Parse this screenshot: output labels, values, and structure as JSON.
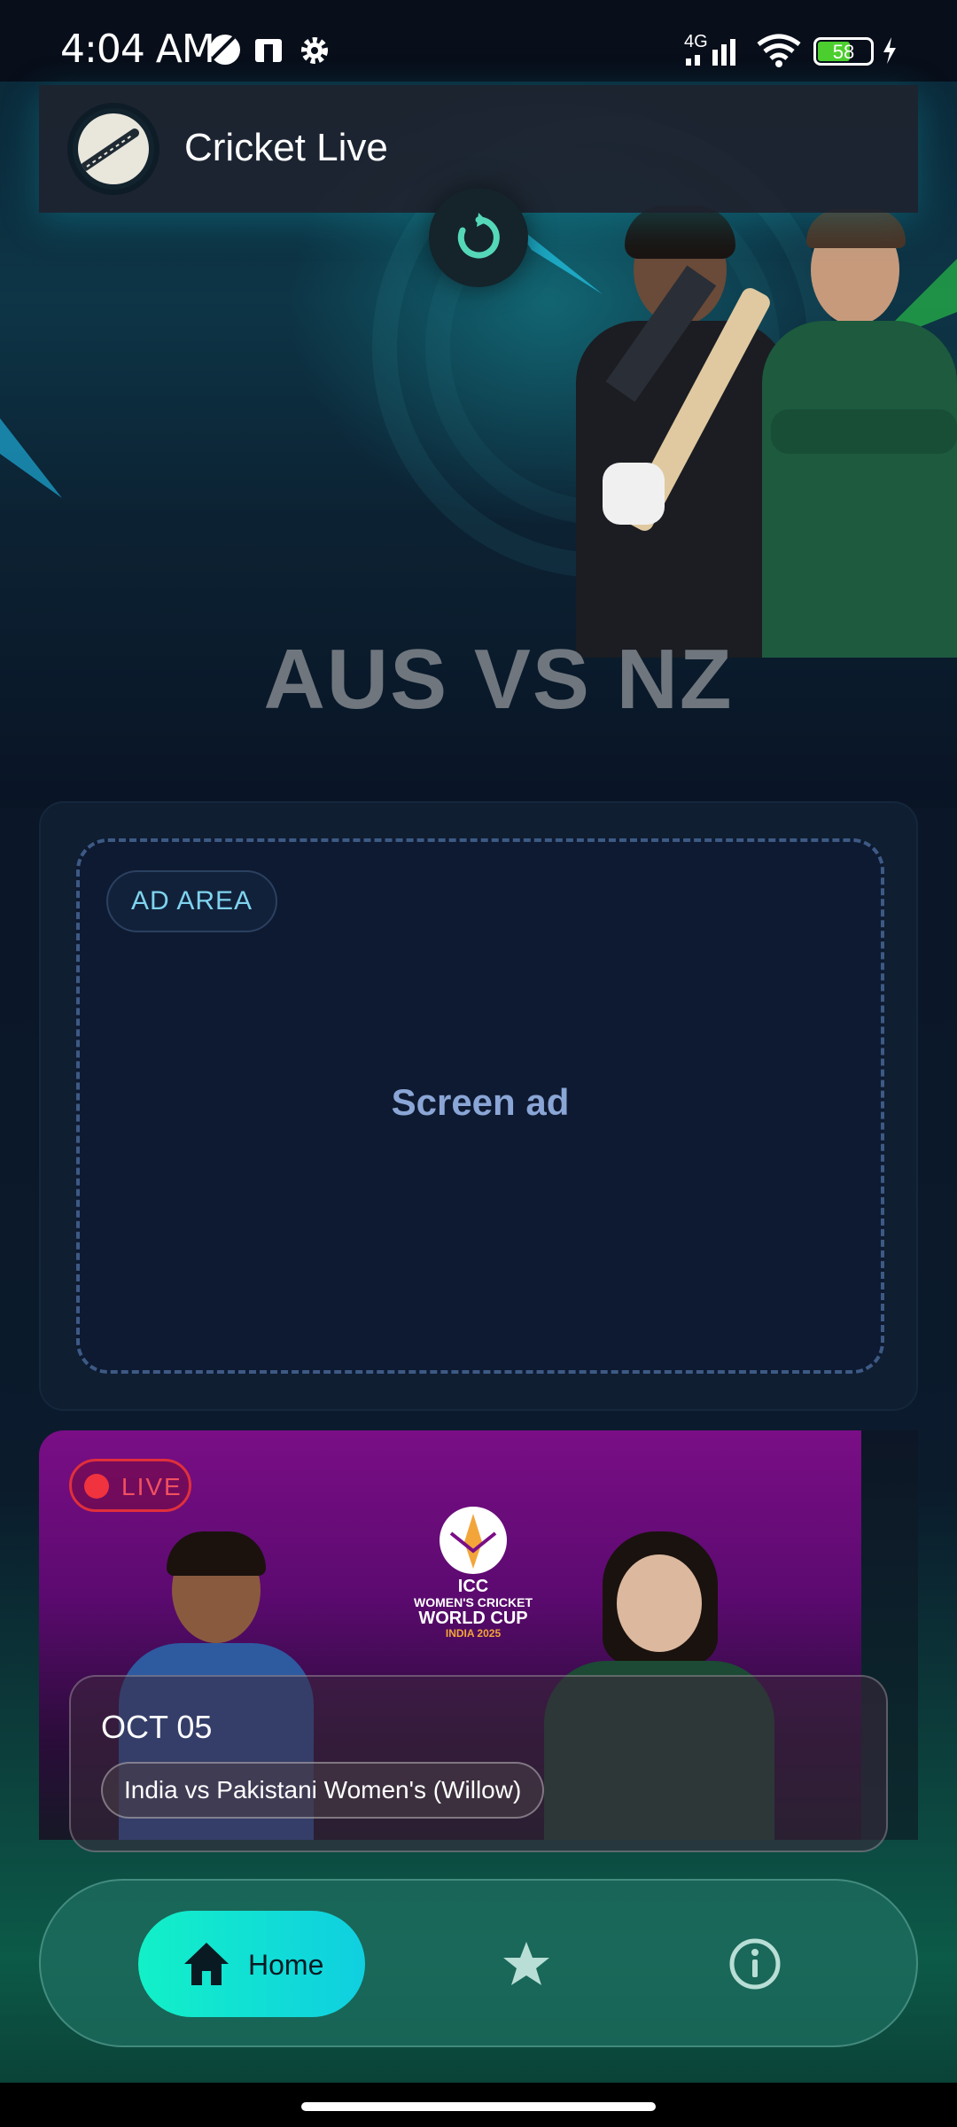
{
  "status_bar": {
    "time": "4:04 AM",
    "network": "4G",
    "battery": "58"
  },
  "header": {
    "app_title": "Cricket Live"
  },
  "hero": {
    "match_title": "AUS VS NZ"
  },
  "ad": {
    "badge": "AD AREA",
    "text": "Screen ad"
  },
  "match_card": {
    "live_label": "LIVE",
    "date": "OCT 05",
    "match_name": "India vs Pakistani Women's (Willow)",
    "logo_lines": [
      "ICC",
      "WOMEN'S CRICKET",
      "WORLD CUP",
      "INDIA 2025"
    ]
  },
  "nav": {
    "home_label": "Home"
  },
  "colors": {
    "accent": "#12f0c8",
    "live_red": "#f0333e",
    "ad_text": "#8aa6d6"
  }
}
